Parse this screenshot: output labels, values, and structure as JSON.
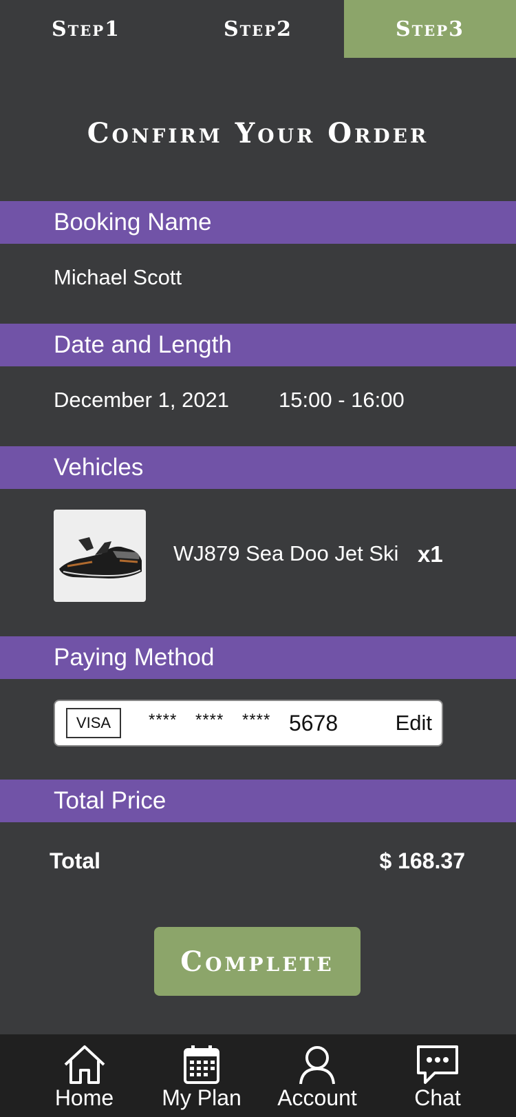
{
  "steps": [
    {
      "label": "Step1"
    },
    {
      "label": "Step2"
    },
    {
      "label": "Step3"
    }
  ],
  "page_title": "Confirm Your Order",
  "sections": {
    "booking": {
      "header": "Booking Name",
      "name": "Michael Scott"
    },
    "date": {
      "header": "Date and Length",
      "date": "December 1, 2021",
      "time": "15:00 - 16:00"
    },
    "vehicles": {
      "header": "Vehicles",
      "items": [
        {
          "name": "WJ879 Sea Doo Jet Ski",
          "qty": "x1"
        }
      ]
    },
    "paying": {
      "header": "Paying Method",
      "brand": "VISA",
      "mask1": "****",
      "mask2": "****",
      "mask3": "****",
      "last4": "5678",
      "edit_label": "Edit"
    },
    "total": {
      "header": "Total Price",
      "label": "Total",
      "value": "$ 168.37"
    }
  },
  "complete_label": "Complete",
  "tabbar": [
    {
      "label": "Home",
      "icon": "home-icon"
    },
    {
      "label": "My Plan",
      "icon": "calendar-icon"
    },
    {
      "label": "Account",
      "icon": "user-icon"
    },
    {
      "label": "Chat",
      "icon": "chat-icon"
    }
  ],
  "colors": {
    "accent_green": "#8ca56a",
    "section_purple": "#7153a7",
    "background": "#3a3b3d",
    "tabbar": "#202020"
  }
}
